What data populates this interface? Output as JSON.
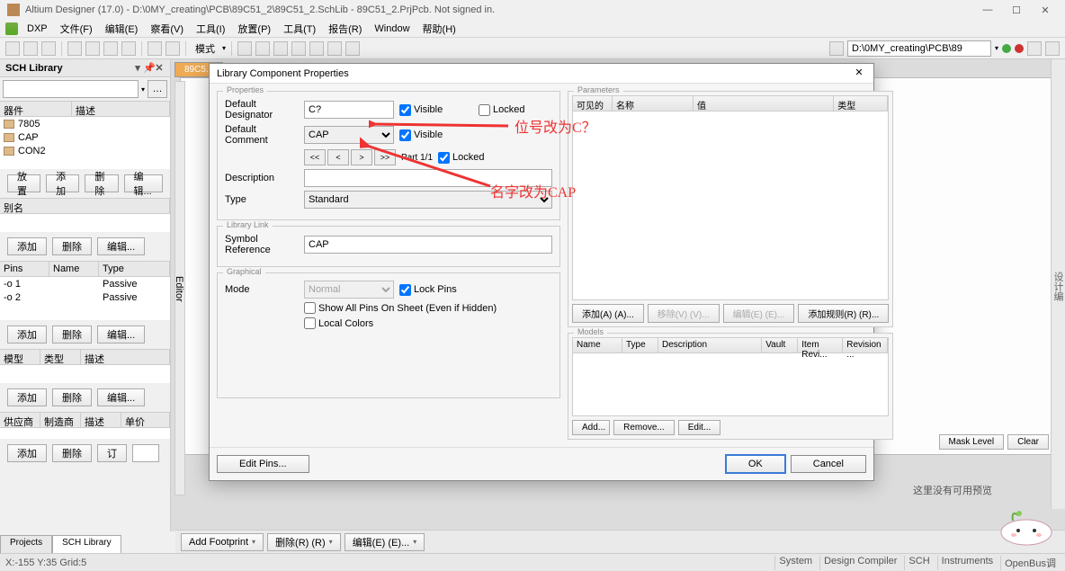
{
  "titlebar": {
    "title": "Altium Designer (17.0) - D:\\0MY_creating\\PCB\\89C51_2\\89C51_2.SchLib - 89C51_2.PrjPcb. Not signed in."
  },
  "menu": {
    "dxp": "DXP",
    "file": "文件(F)",
    "edit": "编辑(E)",
    "view": "察看(V)",
    "tools": "工具(I)",
    "place": "放置(P)",
    "arrange": "工具(T)",
    "report": "报告(R)",
    "window": "Window",
    "help": "帮助(H)"
  },
  "toolbar": {
    "mode": "模式",
    "path": "D:\\0MY_creating\\PCB\\89"
  },
  "leftpanel": {
    "title": "SCH Library",
    "listhdr": {
      "comp": "器件",
      "desc": "描述"
    },
    "components": [
      {
        "name": "7805"
      },
      {
        "name": "CAP"
      },
      {
        "name": "CON2"
      }
    ],
    "btns": {
      "place": "放置",
      "add": "添加",
      "del": "删除",
      "edit": "编辑..."
    },
    "aliaslbl": "别名",
    "alias_btns": {
      "add": "添加",
      "del": "删除",
      "edit": "编辑..."
    },
    "pinshdr": {
      "pins": "Pins",
      "name": "Name",
      "type": "Type"
    },
    "pins": [
      {
        "pin": "-o 1",
        "name": "",
        "type": "Passive"
      },
      {
        "pin": "-o 2",
        "name": "",
        "type": "Passive"
      }
    ],
    "pin_btns": {
      "add": "添加",
      "del": "删除",
      "edit": "编辑..."
    },
    "modelhdr": {
      "model": "模型",
      "type": "类型",
      "desc": "描述"
    },
    "model_btns": {
      "add": "添加",
      "del": "删除",
      "edit": "编辑..."
    },
    "supplierhdr": {
      "supplier": "供应商",
      "mfr": "制造商",
      "desc": "描述",
      "price": "单价"
    },
    "sup_btns": {
      "add": "添加",
      "del": "删除",
      "order": "订"
    }
  },
  "editor": {
    "label": "Editor",
    "model": "模型"
  },
  "bottomtabs": {
    "projects": "Projects",
    "schlib": "SCH Library"
  },
  "bottombar": {
    "addfoot": "Add Footprint",
    "del": "删除(R) (R)",
    "edit": "编辑(E) (E)..."
  },
  "statusbar": {
    "coords": "X:-155 Y:35  Grid:5",
    "r": [
      "System",
      "Design Compiler",
      "SCH",
      "Instruments",
      "OpenBus调"
    ]
  },
  "rightstatus": {
    "mask": "Mask Level",
    "clear": "Clear",
    "preview": "这里没有可用预览"
  },
  "dialog": {
    "title": "Library Component Properties",
    "groups": {
      "prop": "Properties",
      "libedit": "Library Link",
      "graphic": "Graphical",
      "param": "Parameters",
      "models": "Models"
    },
    "labels": {
      "defdes": "Default Designator",
      "defcom": "Default Comment",
      "desc": "Description",
      "type": "Type",
      "symref": "Symbol Reference",
      "mode": "Mode",
      "part": "Part 1/1"
    },
    "values": {
      "designator": "C?",
      "comment": "CAP",
      "type": "Standard",
      "symref": "CAP",
      "mode": "Normal"
    },
    "checks": {
      "visible1": "Visible",
      "locked1": "Locked",
      "visible2": "Visible",
      "locked2": "Locked",
      "showpins": "Show All Pins On Sheet (Even if Hidden)",
      "localcolors": "Local Colors",
      "lockpins": "Lock Pins"
    },
    "navbtns": {
      "first": "<<",
      "prev": "<",
      "next": ">",
      "last": ">>"
    },
    "paramhdr": {
      "visible": "可见的",
      "name": "名称",
      "value": "值",
      "type": "类型"
    },
    "parambtns": {
      "add": "添加(A) (A)...",
      "move": "移除(V) (V)...",
      "edit": "编辑(E) (E)...",
      "addrule": "添加规则(R) (R)..."
    },
    "modelhdr": {
      "name": "Name",
      "type": "Type",
      "desc": "Description",
      "vault": "Vault",
      "itemrev": "Item Revi...",
      "rev": "Revision ..."
    },
    "modelbtns": {
      "add": "Add...",
      "remove": "Remove...",
      "edit": "Edit..."
    },
    "footer": {
      "editpins": "Edit Pins...",
      "ok": "OK",
      "cancel": "Cancel"
    }
  },
  "annotations": {
    "a1": "位号改为C？",
    "a2": "名字改为CAP"
  },
  "sidetab": "设计编"
}
